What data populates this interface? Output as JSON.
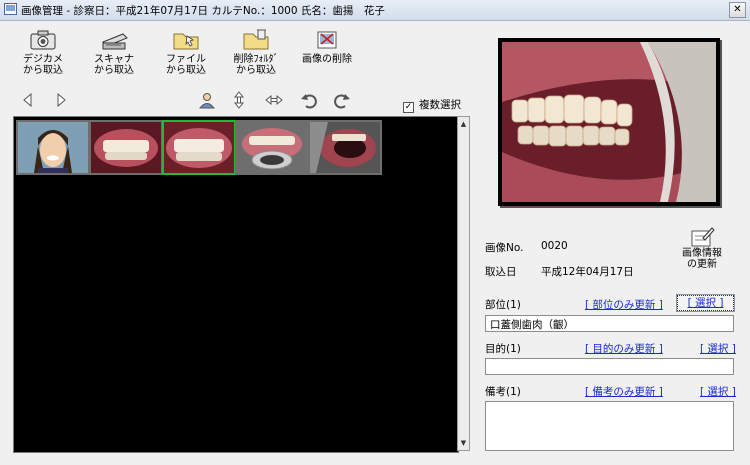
{
  "window": {
    "title": "画像管理 ‐ 診察日：平成21年07月17日 カルテNo.：1000 氏名：歯揚　花子",
    "close_glyph": "✕"
  },
  "toolbar": {
    "camera_label": "デジカメ\nから取込",
    "scanner_label": "スキャナ\nから取込",
    "file_label": "ファイル\nから取込",
    "deleted_folder_label": "削除ﾌｫﾙﾀﾞ\nから取込",
    "delete_image_label": "画像の削除"
  },
  "nav_icons": [
    "arrow-left-icon",
    "arrow-right-icon",
    "person-icon",
    "flip-vertical-icon",
    "flip-horizontal-icon",
    "rotate-left-icon",
    "rotate-right-icon"
  ],
  "multi_select": {
    "label": "複数選択",
    "checked": true,
    "check_glyph": "✓"
  },
  "gallery": {
    "thumbnails": [
      {
        "subject": "face-photo",
        "selected": false
      },
      {
        "subject": "teeth-frontal",
        "selected": false
      },
      {
        "subject": "teeth-frontal-closeup",
        "selected": true
      },
      {
        "subject": "teeth-with-retractor",
        "selected": false
      },
      {
        "subject": "mouth-side-view",
        "selected": false
      }
    ],
    "scroll_up": "▲",
    "scroll_down": "▼"
  },
  "detail": {
    "image_no_label": "画像No.",
    "image_no": "0020",
    "import_date_label": "取込日",
    "import_date": "平成12年04月17日",
    "update_info_label": "画像情報\nの更新"
  },
  "region": {
    "label": "部位(1)",
    "update_link": "[ 部位のみ更新 ]",
    "select_link": "[ 選択 ]",
    "value": "口蓋側歯肉（齦）"
  },
  "purpose": {
    "label": "目的(1)",
    "update_link": "[ 目的のみ更新 ]",
    "select_link": "[ 選択 ]",
    "value": ""
  },
  "remarks": {
    "label": "備考(1)",
    "update_link": "[ 備考のみ更新 ]",
    "select_link": "[ 選択 ]",
    "value": ""
  },
  "colors": {
    "selected_border": "#23b83b",
    "link": "#1a2bd0",
    "gallery_bg": "#000000"
  }
}
